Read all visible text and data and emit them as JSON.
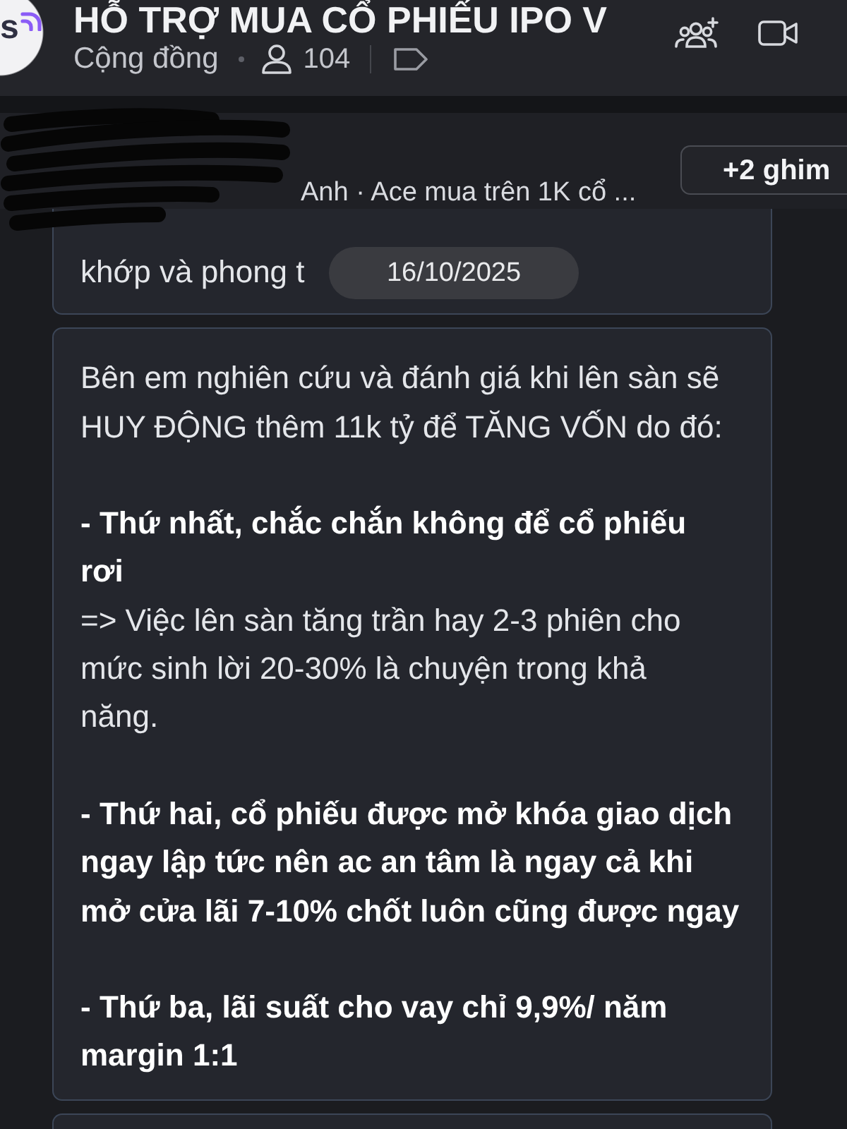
{
  "header": {
    "avatar_letter": "s",
    "title": "HỖ TRỢ MUA CỔ PHIẾU IPO V",
    "community_label": "Cộng đồng",
    "member_count": "104"
  },
  "pinned": {
    "preview": "Anh · Ace mua trên 1K cổ ...",
    "more_button": "+2 ghim"
  },
  "date_label": "16/10/2025",
  "messages": [
    {
      "text": "khớp và phong t"
    },
    {
      "text": "Bên em nghiên cứu và đánh giá khi lên sàn sẽ\nHUY ĐỘNG thêm 11k tỷ để TĂNG VỐN do đó:\n\n**- Thứ nhất, chắc chắn không để cổ phiếu**\n**rơi**\n=> Việc lên sàn tăng trần hay 2-3 phiên cho\nmức sinh lời 20-30% là chuyện trong khả\nnăng.\n\n**- Thứ hai, cổ phiếu được mở khóa giao dịch**\n**ngay lập tức nên ac an tâm là ngay cả khi**\n**mở cửa lãi 7-10% chốt luôn cũng được ngay**\n\n**- Thứ ba, lãi suất cho vay chỉ 9,9%/ năm**\n**margin 1:1**"
    }
  ]
}
